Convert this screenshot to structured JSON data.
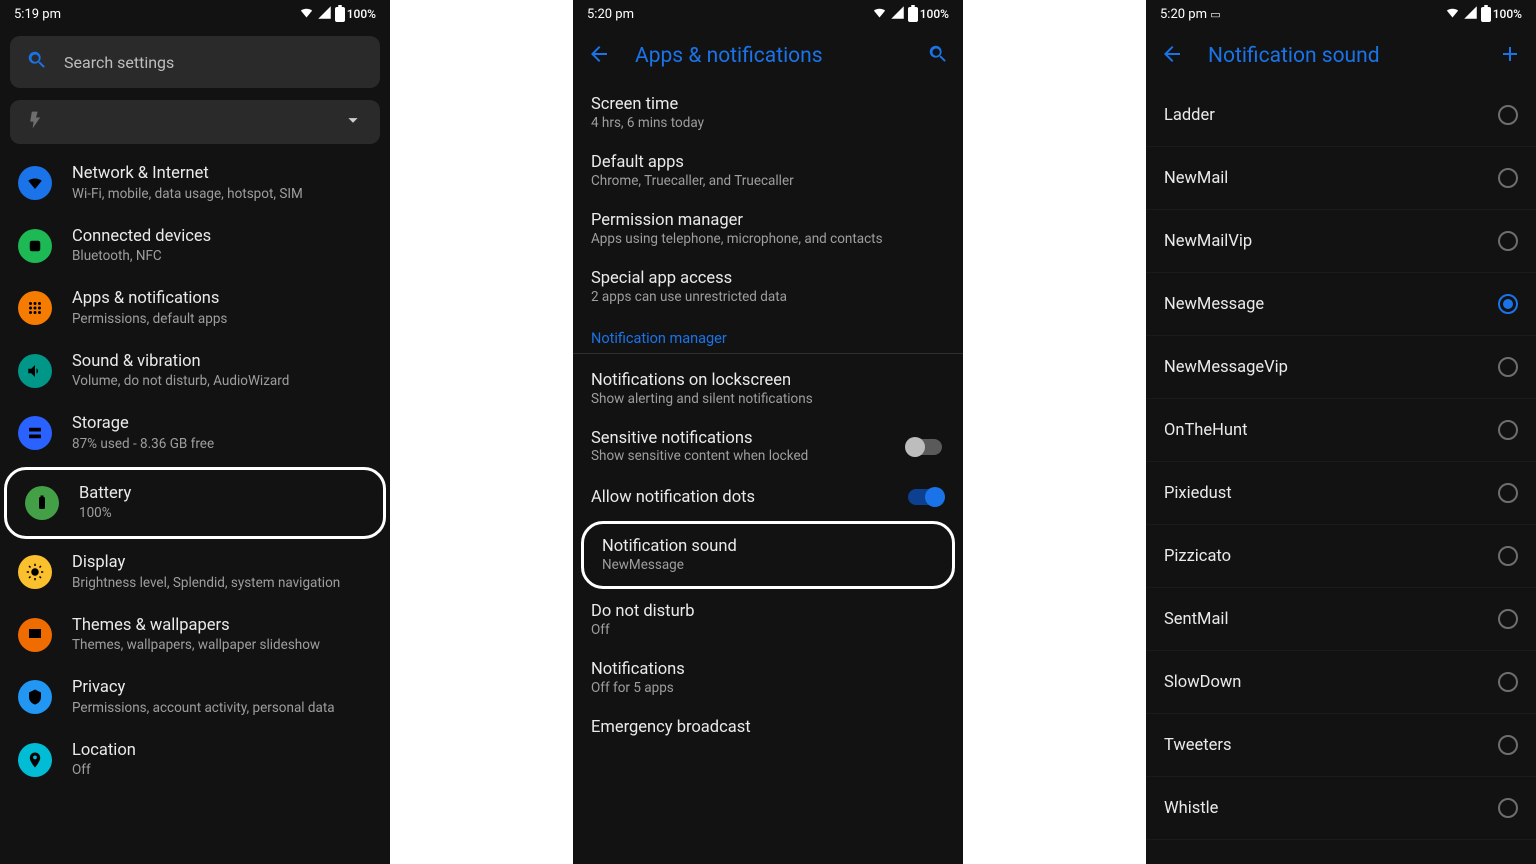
{
  "screen1": {
    "status": {
      "time": "5:19 pm",
      "battery_pct": "100%"
    },
    "search_placeholder": "Search settings",
    "items": [
      {
        "key": "network",
        "title": "Network & Internet",
        "sub": "Wi-Fi, mobile, data usage, hotspot, SIM"
      },
      {
        "key": "connected",
        "title": "Connected devices",
        "sub": "Bluetooth, NFC"
      },
      {
        "key": "apps",
        "title": "Apps & notifications",
        "sub": "Permissions, default apps"
      },
      {
        "key": "sound",
        "title": "Sound & vibration",
        "sub": "Volume, do not disturb, AudioWizard"
      },
      {
        "key": "storage",
        "title": "Storage",
        "sub": "87% used - 8.36 GB free"
      },
      {
        "key": "battery",
        "title": "Battery",
        "sub": "100%"
      },
      {
        "key": "display",
        "title": "Display",
        "sub": "Brightness level, Splendid, system navigation"
      },
      {
        "key": "themes",
        "title": "Themes & wallpapers",
        "sub": "Themes, wallpapers, wallpaper slideshow"
      },
      {
        "key": "privacy",
        "title": "Privacy",
        "sub": "Permissions, account activity, personal data"
      },
      {
        "key": "location",
        "title": "Location",
        "sub": "Off"
      }
    ]
  },
  "screen2": {
    "status": {
      "time": "5:20 pm",
      "battery_pct": "100%"
    },
    "header": "Apps & notifications",
    "section_label": "Notification manager",
    "rows": {
      "screen_time": {
        "title": "Screen time",
        "sub": "4 hrs, 6 mins today"
      },
      "default_apps": {
        "title": "Default apps",
        "sub": "Chrome, Truecaller, and Truecaller"
      },
      "perm_manager": {
        "title": "Permission manager",
        "sub": "Apps using telephone, microphone, and contacts"
      },
      "special_access": {
        "title": "Special app access",
        "sub": "2 apps can use unrestricted data"
      },
      "lockscreen": {
        "title": "Notifications on lockscreen",
        "sub": "Show alerting and silent notifications"
      },
      "sensitive": {
        "title": "Sensitive notifications",
        "sub": "Show sensitive content when locked"
      },
      "allow_dots": {
        "title": "Allow notification dots"
      },
      "notif_sound": {
        "title": "Notification sound",
        "sub": "NewMessage"
      },
      "dnd": {
        "title": "Do not disturb",
        "sub": "Off"
      },
      "notifications": {
        "title": "Notifications",
        "sub": "Off for 5 apps"
      },
      "emergency": {
        "title": "Emergency broadcast"
      }
    }
  },
  "screen3": {
    "status": {
      "time": "5:20 pm",
      "battery_pct": "100%"
    },
    "header": "Notification sound",
    "selected": "NewMessage",
    "options": [
      "Ladder",
      "NewMail",
      "NewMailVip",
      "NewMessage",
      "NewMessageVip",
      "OnTheHunt",
      "Pixiedust",
      "Pizzicato",
      "SentMail",
      "SlowDown",
      "Tweeters",
      "Whistle"
    ]
  }
}
